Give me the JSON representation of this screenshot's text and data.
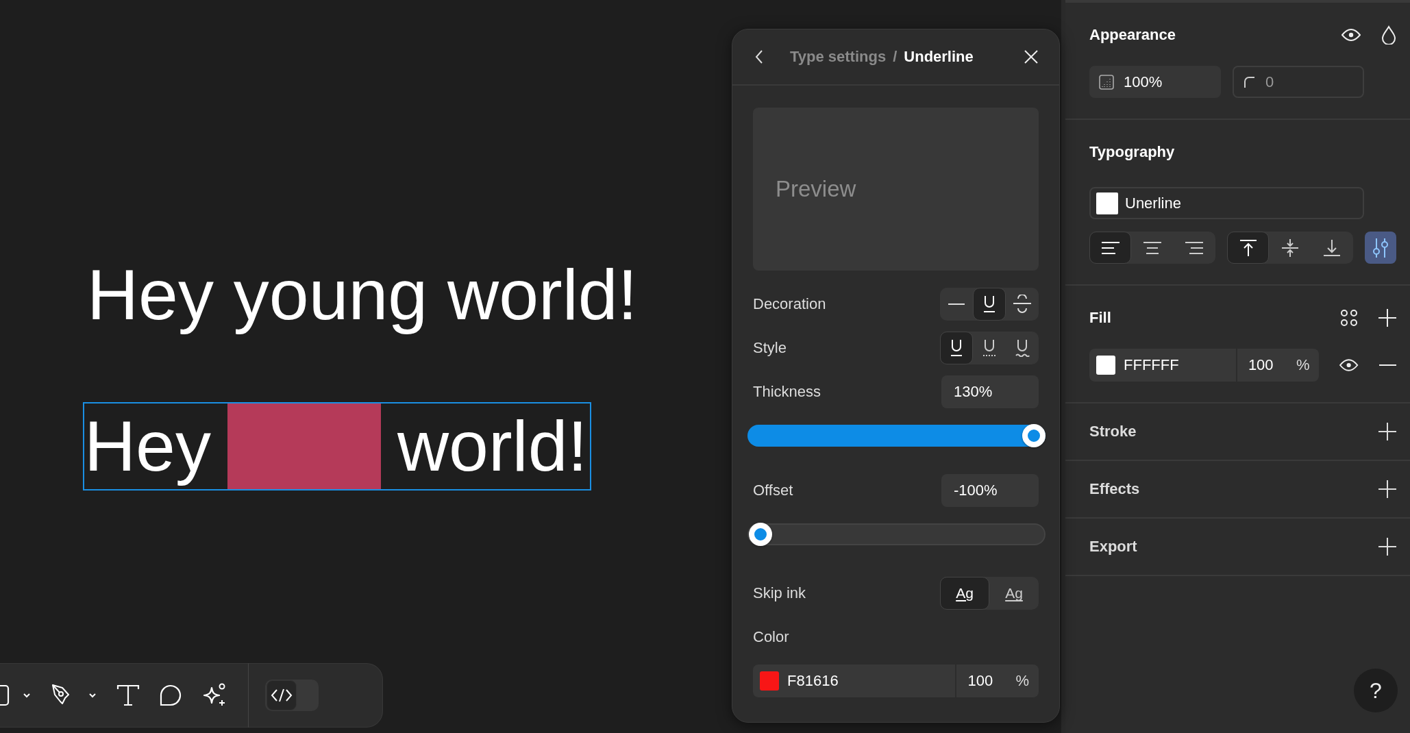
{
  "canvas": {
    "layers": [
      {
        "kind": "text",
        "text": "Hey young world!",
        "selected": false
      },
      {
        "kind": "masked",
        "words": [
          "Hey",
          "world!"
        ],
        "selected": true
      }
    ]
  },
  "type_settings": {
    "parent": "Type settings",
    "separator": "/",
    "current": "Underline",
    "preview": "Preview",
    "decoration": {
      "label": "Decoration",
      "options": [
        {
          "kind": "none",
          "selected": false
        },
        {
          "kind": "underline",
          "selected": true
        },
        {
          "kind": "strikethrough",
          "selected": false
        }
      ]
    },
    "style": {
      "label": "Style",
      "options": [
        {
          "kind": "solid",
          "selected": true
        },
        {
          "kind": "dotted",
          "selected": false
        },
        {
          "kind": "wavy",
          "selected": false
        }
      ]
    },
    "thickness": {
      "label": "Thickness",
      "value": "130%",
      "level": 1
    },
    "offset": {
      "label": "Offset",
      "value": "-100%",
      "level": 0
    },
    "skip_ink": {
      "label": "Skip ink",
      "options": [
        {
          "label": "Ag",
          "kind": "skip",
          "selected": true
        },
        {
          "label": "Ag",
          "kind": "through",
          "selected": false
        }
      ]
    },
    "color": {
      "label": "Color",
      "hex": "F81616",
      "color": "#f81616",
      "opacity": "100",
      "unit": "%"
    }
  },
  "inspector": {
    "appearance": {
      "title": "Appearance",
      "opacity": "100%",
      "radius": "0"
    },
    "typography": {
      "title": "Typography",
      "font": "Unerline",
      "h_align": [
        {
          "kind": "left",
          "selected": true
        },
        {
          "kind": "center",
          "selected": false
        },
        {
          "kind": "right",
          "selected": false
        }
      ],
      "v_align": [
        {
          "kind": "top",
          "selected": true
        },
        {
          "kind": "middle",
          "selected": false
        },
        {
          "kind": "bottom",
          "selected": false
        }
      ],
      "settings_open": true
    },
    "fill": {
      "title": "Fill",
      "hex": "FFFFFF",
      "color": "#ffffff",
      "opacity": "100",
      "unit": "%",
      "visible": true
    },
    "sections": [
      "Stroke",
      "Effects",
      "Export"
    ],
    "help": "?"
  },
  "toolbar": {
    "dev_mode": false
  }
}
